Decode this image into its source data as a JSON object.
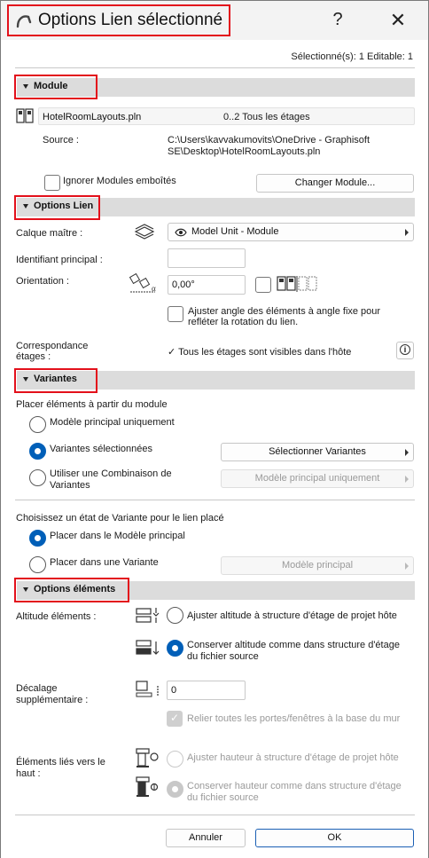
{
  "window": {
    "title": "Options Lien sélectionné",
    "help": "?",
    "close": "✕"
  },
  "selection_info": "Sélectionné(s): 1 Editable: 1",
  "module": {
    "header": "Module",
    "file_name": "HotelRoomLayouts.pln",
    "stories": "0..2 Tous les étages",
    "source_label": "Source :",
    "source_line1": "C:\\Users\\kavvakumovits\\OneDrive - Graphisoft",
    "source_line2": "SE\\Desktop\\HotelRoomLayouts.pln",
    "ignore_nested_label": "Ignorer Modules emboîtés",
    "change_module_button": "Changer Module..."
  },
  "link_options": {
    "header": "Options Lien",
    "master_layer_label": "Calque maître :",
    "master_layer_value": "Model Unit - Module",
    "main_id_label": "Identifiant principal :",
    "main_id_value": "",
    "orientation_label": "Orientation :",
    "orientation_value": "0,00°",
    "adjust_angle_line1": "Ajuster angle des éléments à angle fixe pour",
    "adjust_angle_line2": "refléter la rotation du lien.",
    "story_match_line1": "Correspondance",
    "story_match_line2": "étages :",
    "story_match_value": "✓ Tous les étages sont visibles dans l'hôte",
    "info_icon": "i"
  },
  "variants": {
    "header": "Variantes",
    "place_from_label": "Placer éléments à partir du module",
    "opt_main_only": "Modèle principal uniquement",
    "opt_selected": "Variantes sélectionnées",
    "opt_combination_line1": "Utiliser une Combinaison de",
    "opt_combination_line2": "Variantes",
    "select_variants_button": "Sélectionner Variantes",
    "combination_dropdown": "Modèle principal uniquement",
    "state_label": "Choisissez un état de Variante pour le lien placé",
    "place_in_main": "Placer dans le Modèle principal",
    "place_in_variant": "Placer dans une Variante",
    "variant_dropdown": "Modèle principal"
  },
  "element_options": {
    "header": "Options éléments",
    "elevation_label": "Altitude éléments :",
    "elev_adjust": "Ajuster altitude à structure d'étage de projet hôte",
    "elev_keep_line1": "Conserver altitude comme dans structure d'étage",
    "elev_keep_line2": "du fichier source",
    "offset_label_line1": "Décalage",
    "offset_label_line2": "supplémentaire :",
    "offset_value": "0",
    "relink_doors": "Relier toutes les portes/fenêtres à la base du mur",
    "linked_top_line1": "Éléments liés vers le",
    "linked_top_line2": "haut :",
    "height_adjust": "Ajuster hauteur à structure d'étage de projet hôte",
    "height_keep_line1": "Conserver hauteur comme dans structure d'étage",
    "height_keep_line2": "du fichier source"
  },
  "footer": {
    "cancel": "Annuler",
    "ok": "OK"
  },
  "colors": {
    "accent": "#005fb8",
    "highlight_box": "#e3101b",
    "section_bar": "#dcdcdc"
  }
}
